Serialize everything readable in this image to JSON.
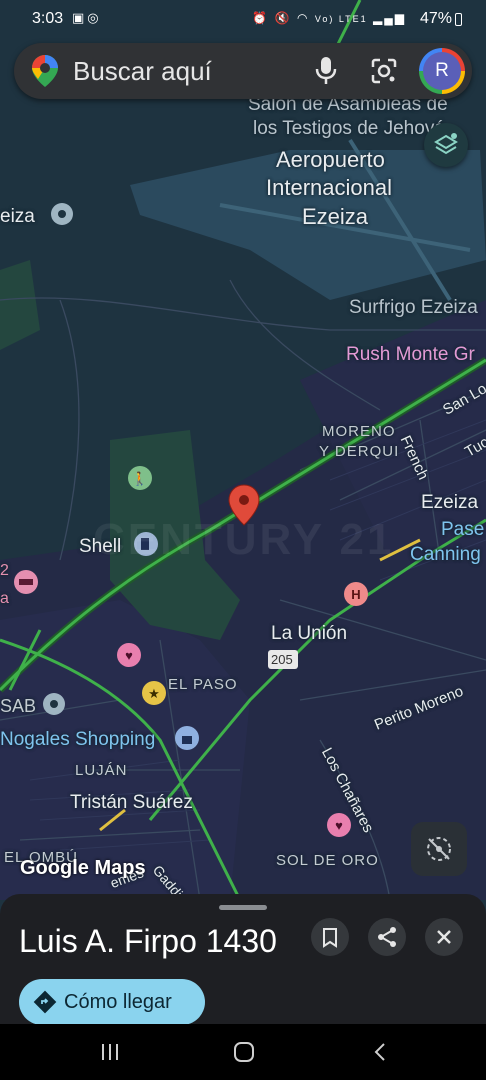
{
  "status_bar": {
    "time": "3:03",
    "left_icons": [
      "gallery-icon",
      "whatsapp-icon"
    ],
    "right_icons": [
      "alarm-icon",
      "mute-icon",
      "wifi-icon",
      "volte-icon",
      "signal-icon"
    ],
    "volte_label": "Vo) LTE1",
    "battery": "47%"
  },
  "search": {
    "placeholder": "Buscar aquí",
    "avatar_letter": "R"
  },
  "map": {
    "labels": {
      "salon": "Salón de Asambleas de",
      "testigos": "los Testigos de Jehová",
      "aeropuerto": "Aeropuerto",
      "internacional": "Internacional",
      "ezeiza_airport": "Ezeiza",
      "ezeiza_left": "eiza",
      "surfrigo": "Surfrigo Ezeiza",
      "rush": "Rush Monte Gr",
      "moreno": "MORENO",
      "y_derqui": "Y DERQUI",
      "san_lo": "San Lo",
      "tuc": "Tuc",
      "french": "French",
      "ezeiza_town": "Ezeiza",
      "paseo": "Pase",
      "canning": "Canning",
      "shell": "Shell",
      "watermark": "CENTURY 21",
      "la_union": "La Unión",
      "route": "205",
      "el_paso": "EL PASO",
      "perito_moreno": "Perito Moreno",
      "sab": "SAB",
      "nogales": "Nogales Shopping",
      "lujan": "LUJÁN",
      "los_chanares": "Los Chañares",
      "tristan": "Tristán Suárez",
      "el_ombu": "EL OMBÚ",
      "sol_de_oro": "SOL DE ORO",
      "gaddi": "Gaddi",
      "emes": "emes",
      "left_edge": "2",
      "left_edge2": "a"
    },
    "logo": "Google Maps"
  },
  "place": {
    "title": "Luis A. Firpo 1430",
    "directions_label": "Cómo llegar"
  },
  "colors": {
    "map_bg": "#1e3340",
    "sheet_bg": "#1e1f23",
    "accent": "#8ad3ee",
    "pin": "#e04a3a",
    "traffic": "#3fb14a"
  }
}
